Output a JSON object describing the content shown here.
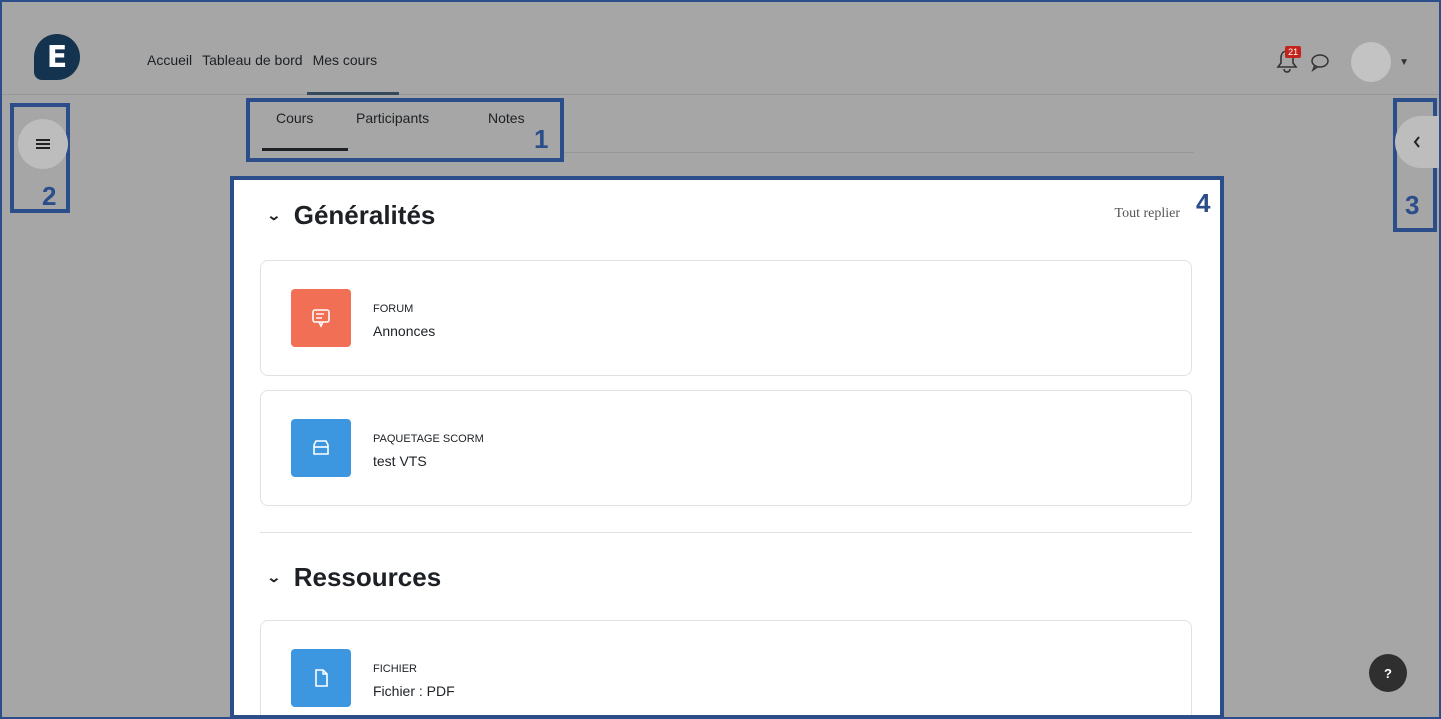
{
  "brand": {
    "logo_letter": "E",
    "color": "#13334f"
  },
  "nav": {
    "links": [
      "Accueil",
      "Tableau de bord",
      "Mes cours"
    ],
    "active": "Mes cours"
  },
  "header_right": {
    "notification_count": "21"
  },
  "tabs": {
    "items": [
      "Cours",
      "Participants",
      "Notes"
    ],
    "active": "Cours"
  },
  "callouts": {
    "tabs": "1",
    "left_drawer": "2",
    "right_drawer": "3",
    "content": "4"
  },
  "sections": [
    {
      "title": "Généralités",
      "collapse_label": "Tout replier",
      "activities": [
        {
          "type": "FORUM",
          "name": "Annonces",
          "icon": "forum-icon",
          "color": "#f16f54"
        },
        {
          "type": "PAQUETAGE SCORM",
          "name": "test VTS",
          "icon": "package-icon",
          "color": "#3c97e0"
        }
      ]
    },
    {
      "title": "Ressources",
      "activities": [
        {
          "type": "FICHIER",
          "name": "Fichier : PDF",
          "icon": "file-icon",
          "color": "#3c97e0"
        }
      ]
    }
  ],
  "help": {
    "label": "?"
  }
}
